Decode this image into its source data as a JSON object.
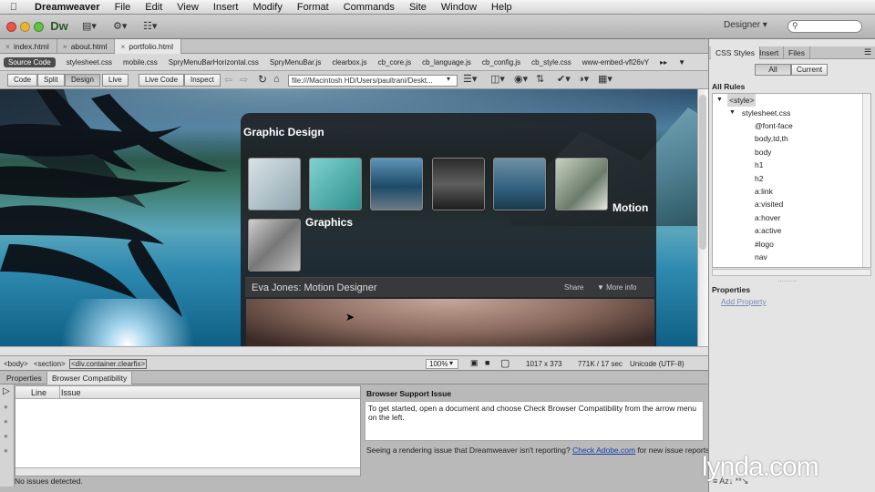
{
  "menubar": {
    "app_name": "Dreamweaver",
    "items": [
      "File",
      "Edit",
      "View",
      "Insert",
      "Modify",
      "Format",
      "Commands",
      "Site",
      "Window",
      "Help"
    ]
  },
  "appbar": {
    "logo": "Dw",
    "workspace": "Designer",
    "search_placeholder": ""
  },
  "doc_tabs": [
    "index.html",
    "about.html",
    "portfolio.html"
  ],
  "related_files": {
    "source": "Source Code",
    "files": [
      "stylesheet.css",
      "mobile.css",
      "SpryMenuBarHorizontal.css",
      "SpryMenuBar.js",
      "clearbox.js",
      "cb_core.js",
      "cb_language.js",
      "cb_config.js",
      "cb_style.css",
      "www-embed-vfl26vY"
    ]
  },
  "doc_toolbar": {
    "views": [
      "Code",
      "Split",
      "Design",
      "Live"
    ],
    "live_code": "Live Code",
    "inspect": "Inspect",
    "address": "file:///Macintosh HD/Users/paultrani/Deskt..."
  },
  "portfolio": {
    "title": "Graphic Design",
    "label_motion": "Motion",
    "label_graphics": "Graphics",
    "name": "Eva Jones: Motion Designer",
    "share": "Share",
    "more_info": "More info"
  },
  "statusbar": {
    "tags": [
      "<body>",
      "<section>",
      "<div.container.clearfix>"
    ],
    "zoom": "100%",
    "dimensions": "1017 x 373",
    "size": "771K / 17 sec",
    "encoding": "Unicode (UTF-8)"
  },
  "bottom_panel": {
    "tabs": [
      "Properties",
      "Browser Compatibility"
    ],
    "col_line": "Line",
    "col_issue": "Issue",
    "status": "No issues detected.",
    "bsi_title": "Browser Support Issue",
    "bsi_text": "To get started, open a document and choose Check Browser Compatibility from the arrow menu on the left.",
    "render_pre": "Seeing a rendering issue that Dreamweaver isn't reporting?",
    "render_link": "Check Adobe.com",
    "render_post": "for new issue reports."
  },
  "right_panel": {
    "tabs": [
      "CSS Styles",
      "Insert",
      "Files"
    ],
    "mode_all": "All",
    "mode_current": "Current",
    "all_rules": "All Rules",
    "rules": [
      "<style>",
      "stylesheet.css",
      "@font-face",
      "body,td,th",
      "body",
      "h1",
      "h2",
      "a:link",
      "a:visited",
      "a:hover",
      "a:active",
      "#logo",
      "nav"
    ],
    "properties": "Properties",
    "add_property": "Add Property"
  },
  "watermark": "lynda.com"
}
